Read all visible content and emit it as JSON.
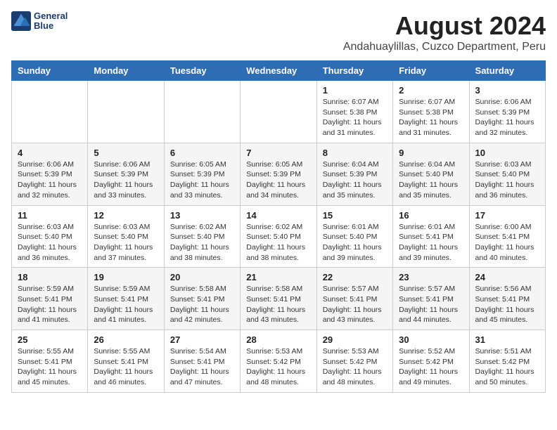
{
  "header": {
    "logo": {
      "line1": "General",
      "line2": "Blue"
    },
    "title": "August 2024",
    "subtitle": "Andahuaylillas, Cuzco Department, Peru"
  },
  "weekdays": [
    "Sunday",
    "Monday",
    "Tuesday",
    "Wednesday",
    "Thursday",
    "Friday",
    "Saturday"
  ],
  "weeks": [
    [
      {
        "day": "",
        "info": ""
      },
      {
        "day": "",
        "info": ""
      },
      {
        "day": "",
        "info": ""
      },
      {
        "day": "",
        "info": ""
      },
      {
        "day": "1",
        "info": "Sunrise: 6:07 AM\nSunset: 5:38 PM\nDaylight: 11 hours\nand 31 minutes."
      },
      {
        "day": "2",
        "info": "Sunrise: 6:07 AM\nSunset: 5:38 PM\nDaylight: 11 hours\nand 31 minutes."
      },
      {
        "day": "3",
        "info": "Sunrise: 6:06 AM\nSunset: 5:39 PM\nDaylight: 11 hours\nand 32 minutes."
      }
    ],
    [
      {
        "day": "4",
        "info": "Sunrise: 6:06 AM\nSunset: 5:39 PM\nDaylight: 11 hours\nand 32 minutes."
      },
      {
        "day": "5",
        "info": "Sunrise: 6:06 AM\nSunset: 5:39 PM\nDaylight: 11 hours\nand 33 minutes."
      },
      {
        "day": "6",
        "info": "Sunrise: 6:05 AM\nSunset: 5:39 PM\nDaylight: 11 hours\nand 33 minutes."
      },
      {
        "day": "7",
        "info": "Sunrise: 6:05 AM\nSunset: 5:39 PM\nDaylight: 11 hours\nand 34 minutes."
      },
      {
        "day": "8",
        "info": "Sunrise: 6:04 AM\nSunset: 5:39 PM\nDaylight: 11 hours\nand 35 minutes."
      },
      {
        "day": "9",
        "info": "Sunrise: 6:04 AM\nSunset: 5:40 PM\nDaylight: 11 hours\nand 35 minutes."
      },
      {
        "day": "10",
        "info": "Sunrise: 6:03 AM\nSunset: 5:40 PM\nDaylight: 11 hours\nand 36 minutes."
      }
    ],
    [
      {
        "day": "11",
        "info": "Sunrise: 6:03 AM\nSunset: 5:40 PM\nDaylight: 11 hours\nand 36 minutes."
      },
      {
        "day": "12",
        "info": "Sunrise: 6:03 AM\nSunset: 5:40 PM\nDaylight: 11 hours\nand 37 minutes."
      },
      {
        "day": "13",
        "info": "Sunrise: 6:02 AM\nSunset: 5:40 PM\nDaylight: 11 hours\nand 38 minutes."
      },
      {
        "day": "14",
        "info": "Sunrise: 6:02 AM\nSunset: 5:40 PM\nDaylight: 11 hours\nand 38 minutes."
      },
      {
        "day": "15",
        "info": "Sunrise: 6:01 AM\nSunset: 5:40 PM\nDaylight: 11 hours\nand 39 minutes."
      },
      {
        "day": "16",
        "info": "Sunrise: 6:01 AM\nSunset: 5:41 PM\nDaylight: 11 hours\nand 39 minutes."
      },
      {
        "day": "17",
        "info": "Sunrise: 6:00 AM\nSunset: 5:41 PM\nDaylight: 11 hours\nand 40 minutes."
      }
    ],
    [
      {
        "day": "18",
        "info": "Sunrise: 5:59 AM\nSunset: 5:41 PM\nDaylight: 11 hours\nand 41 minutes."
      },
      {
        "day": "19",
        "info": "Sunrise: 5:59 AM\nSunset: 5:41 PM\nDaylight: 11 hours\nand 41 minutes."
      },
      {
        "day": "20",
        "info": "Sunrise: 5:58 AM\nSunset: 5:41 PM\nDaylight: 11 hours\nand 42 minutes."
      },
      {
        "day": "21",
        "info": "Sunrise: 5:58 AM\nSunset: 5:41 PM\nDaylight: 11 hours\nand 43 minutes."
      },
      {
        "day": "22",
        "info": "Sunrise: 5:57 AM\nSunset: 5:41 PM\nDaylight: 11 hours\nand 43 minutes."
      },
      {
        "day": "23",
        "info": "Sunrise: 5:57 AM\nSunset: 5:41 PM\nDaylight: 11 hours\nand 44 minutes."
      },
      {
        "day": "24",
        "info": "Sunrise: 5:56 AM\nSunset: 5:41 PM\nDaylight: 11 hours\nand 45 minutes."
      }
    ],
    [
      {
        "day": "25",
        "info": "Sunrise: 5:55 AM\nSunset: 5:41 PM\nDaylight: 11 hours\nand 45 minutes."
      },
      {
        "day": "26",
        "info": "Sunrise: 5:55 AM\nSunset: 5:41 PM\nDaylight: 11 hours\nand 46 minutes."
      },
      {
        "day": "27",
        "info": "Sunrise: 5:54 AM\nSunset: 5:41 PM\nDaylight: 11 hours\nand 47 minutes."
      },
      {
        "day": "28",
        "info": "Sunrise: 5:53 AM\nSunset: 5:42 PM\nDaylight: 11 hours\nand 48 minutes."
      },
      {
        "day": "29",
        "info": "Sunrise: 5:53 AM\nSunset: 5:42 PM\nDaylight: 11 hours\nand 48 minutes."
      },
      {
        "day": "30",
        "info": "Sunrise: 5:52 AM\nSunset: 5:42 PM\nDaylight: 11 hours\nand 49 minutes."
      },
      {
        "day": "31",
        "info": "Sunrise: 5:51 AM\nSunset: 5:42 PM\nDaylight: 11 hours\nand 50 minutes."
      }
    ]
  ]
}
